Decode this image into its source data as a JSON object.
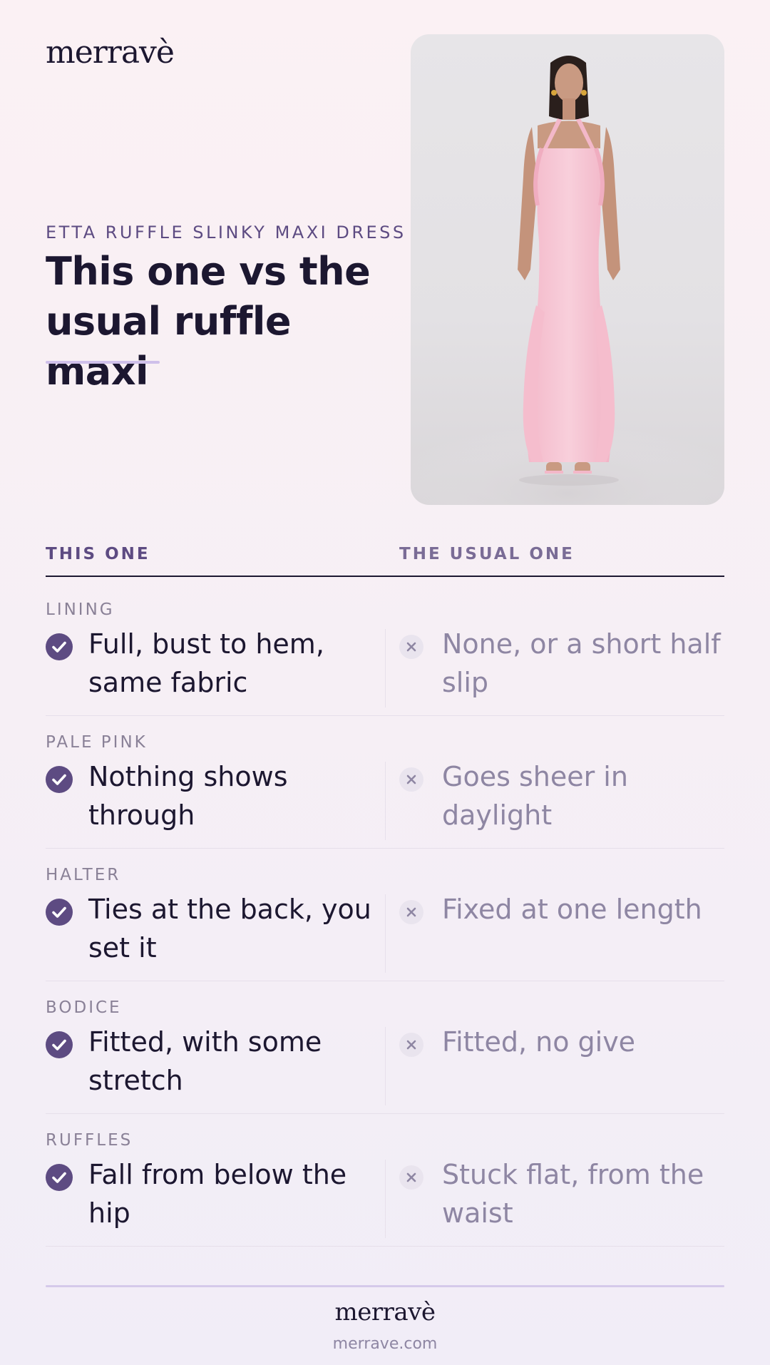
{
  "brand": {
    "logo": "merravè",
    "url": "merrave.com"
  },
  "hero": {
    "eyebrow": "ETTA RUFFLE SLINKY MAXI DRESS",
    "headline": "This one vs the usual ruffle maxi",
    "photo_icon": "model-photo"
  },
  "comparison": {
    "col_this": "THIS ONE",
    "col_usual": "THE USUAL ONE",
    "rows": [
      {
        "label": "LINING",
        "this": "Full, bust to hem, same fabric",
        "usual": "None, or a short half slip"
      },
      {
        "label": "PALE PINK",
        "this": "Nothing shows through",
        "usual": "Goes sheer in daylight"
      },
      {
        "label": "HALTER",
        "this": "Ties at the back, you set it",
        "usual": "Fixed at one length"
      },
      {
        "label": "BODICE",
        "this": "Fitted, with some stretch",
        "usual": "Fitted, no give"
      },
      {
        "label": "RUFFLES",
        "this": "Fall from below the hip",
        "usual": "Stuck flat, from the waist"
      }
    ]
  },
  "colors": {
    "accent": "#5d4b82",
    "ink": "#1c1730",
    "muted": "#8e86a3",
    "dress": "#f6c6d4"
  }
}
